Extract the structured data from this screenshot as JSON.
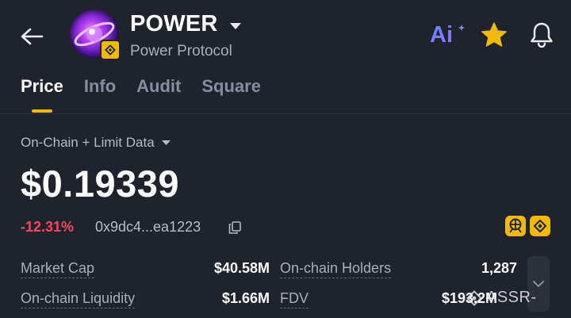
{
  "header": {
    "symbol": "POWER",
    "name": "Power Protocol",
    "ai_label": "Ai",
    "icons": {
      "back": "arrow-left-icon",
      "caret": "caret-down-icon",
      "ai": "ai-icon",
      "favorite": "star-icon",
      "notifications": "bell-icon",
      "chain_badge": "bnb-chain-icon"
    },
    "colors": {
      "favorite": "#f0b90b",
      "accent": "#f0b90b"
    }
  },
  "tabs": [
    {
      "label": "Price",
      "active": true
    },
    {
      "label": "Info",
      "active": false
    },
    {
      "label": "Audit",
      "active": false
    },
    {
      "label": "Square",
      "active": false
    }
  ],
  "market": {
    "data_source": "On-Chain + Limit Data",
    "price": "$0.19339",
    "change": "-12.31%",
    "change_color": "#f6465d",
    "contract": "0x9dc4...ea1223"
  },
  "stats": {
    "market_cap_label": "Market Cap",
    "market_cap_value": "$40.58M",
    "holders_label": "On-chain Holders",
    "holders_value": "1,287",
    "liquidity_label": "On-chain Liquidity",
    "liquidity_value": "$1.66M",
    "fdv_label": "FDV",
    "fdv_value": "$193.2M"
  },
  "watermark": "ASSR-"
}
